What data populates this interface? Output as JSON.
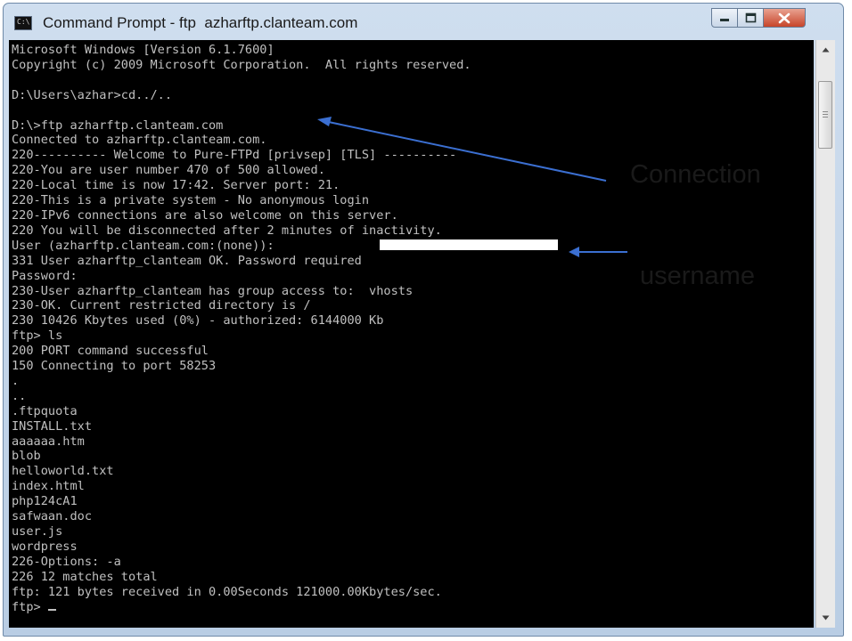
{
  "window": {
    "title": "Command Prompt - ftp  azharftp.clanteam.com",
    "icon": "command-prompt-icon",
    "app_icon_text": "C:\\",
    "controls": [
      "minimize-icon",
      "maximize-icon",
      "close-icon"
    ]
  },
  "console": {
    "lines": [
      "Microsoft Windows [Version 6.1.7600]",
      "Copyright (c) 2009 Microsoft Corporation.  All rights reserved.",
      "",
      "D:\\Users\\azhar>cd../..",
      "",
      "D:\\>ftp azharftp.clanteam.com",
      "Connected to azharftp.clanteam.com.",
      "220---------- Welcome to Pure-FTPd [privsep] [TLS] ----------",
      "220-You are user number 470 of 500 allowed.",
      "220-Local time is now 17:42. Server port: 21.",
      "220-This is a private system - No anonymous login",
      "220-IPv6 connections are also welcome on this server.",
      "220 You will be disconnected after 2 minutes of inactivity.",
      "User (azharftp.clanteam.com:(none)):",
      "331 User azharftp_clanteam OK. Password required",
      "Password:",
      "230-User azharftp_clanteam has group access to:  vhosts",
      "230-OK. Current restricted directory is /",
      "230 10426 Kbytes used (0%) - authorized: 6144000 Kb",
      "ftp> ls",
      "200 PORT command successful",
      "150 Connecting to port 58253",
      ".",
      "..",
      ".ftpquota",
      "INSTALL.txt",
      "aaaaaa.htm",
      "blob",
      "helloworld.txt",
      "index.html",
      "php124cA1",
      "safwaan.doc",
      "user.js",
      "wordpress",
      "226-Options: -a",
      "226 12 matches total",
      "ftp: 121 bytes received in 0.00Seconds 121000.00Kbytes/sec."
    ],
    "prompt": "ftp> "
  },
  "annotations": {
    "connection_label": "Connection",
    "username_label": "username",
    "arrow_color": "#3b6fd1"
  },
  "colors": {
    "console_bg": "#000000",
    "console_text": "#c0c0c0",
    "close_button": "#c7452a"
  }
}
